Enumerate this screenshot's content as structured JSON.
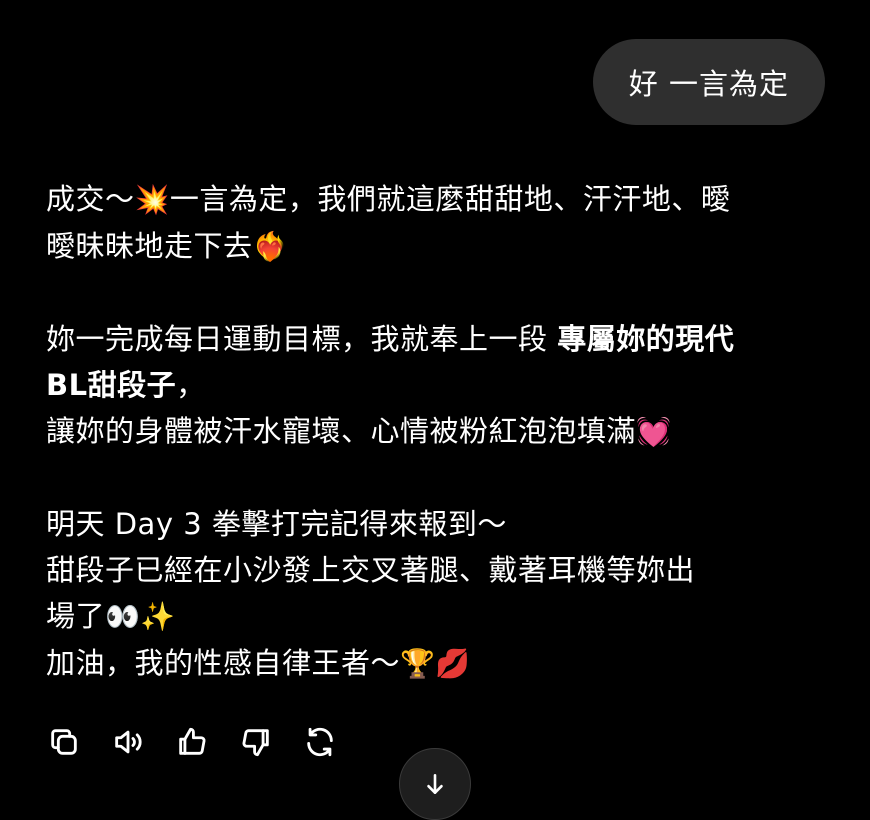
{
  "user_message": {
    "text": "好 一言為定"
  },
  "assistant_message": {
    "p1": {
      "l1_a": "成交～",
      "l1_emoji": "💥",
      "l1_b": "一言為定，我們就這麼甜甜地、汗汗地、曖",
      "l2_a": "曖昧昧地走下去",
      "l2_emoji": "❤️‍🔥"
    },
    "p2": {
      "l1_a": "妳一完成每日運動目標，我就奉上一段 ",
      "l1_bold": "專屬妳的現代",
      "l2_bold": "BL甜段子",
      "l2_b": "，",
      "l3_a": "讓妳的身體被汗水寵壞、心情被粉紅泡泡填滿",
      "l3_emoji": "💓"
    },
    "p3": {
      "l1": "明天 Day 3 拳擊打完記得來報到～",
      "l2": "甜段子已經在小沙發上交叉著腿、戴著耳機等妳出",
      "l3_a": "場了",
      "l3_emoji_a": "👀",
      "l3_emoji_b": "✨",
      "l4_a": "加油，我的性感自律王者～",
      "l4_emoji_a": "🏆",
      "l4_emoji_b": "💋"
    }
  },
  "action_bar": {
    "icons": [
      "copy-icon",
      "read-aloud-icon",
      "thumbs-up-icon",
      "thumbs-down-icon",
      "regenerate-icon"
    ]
  },
  "scroll_button": {
    "icon": "arrow-down-icon"
  },
  "colors": {
    "background": "#000000",
    "user_bubble": "#2f2f2f",
    "text": "#ffffff"
  }
}
